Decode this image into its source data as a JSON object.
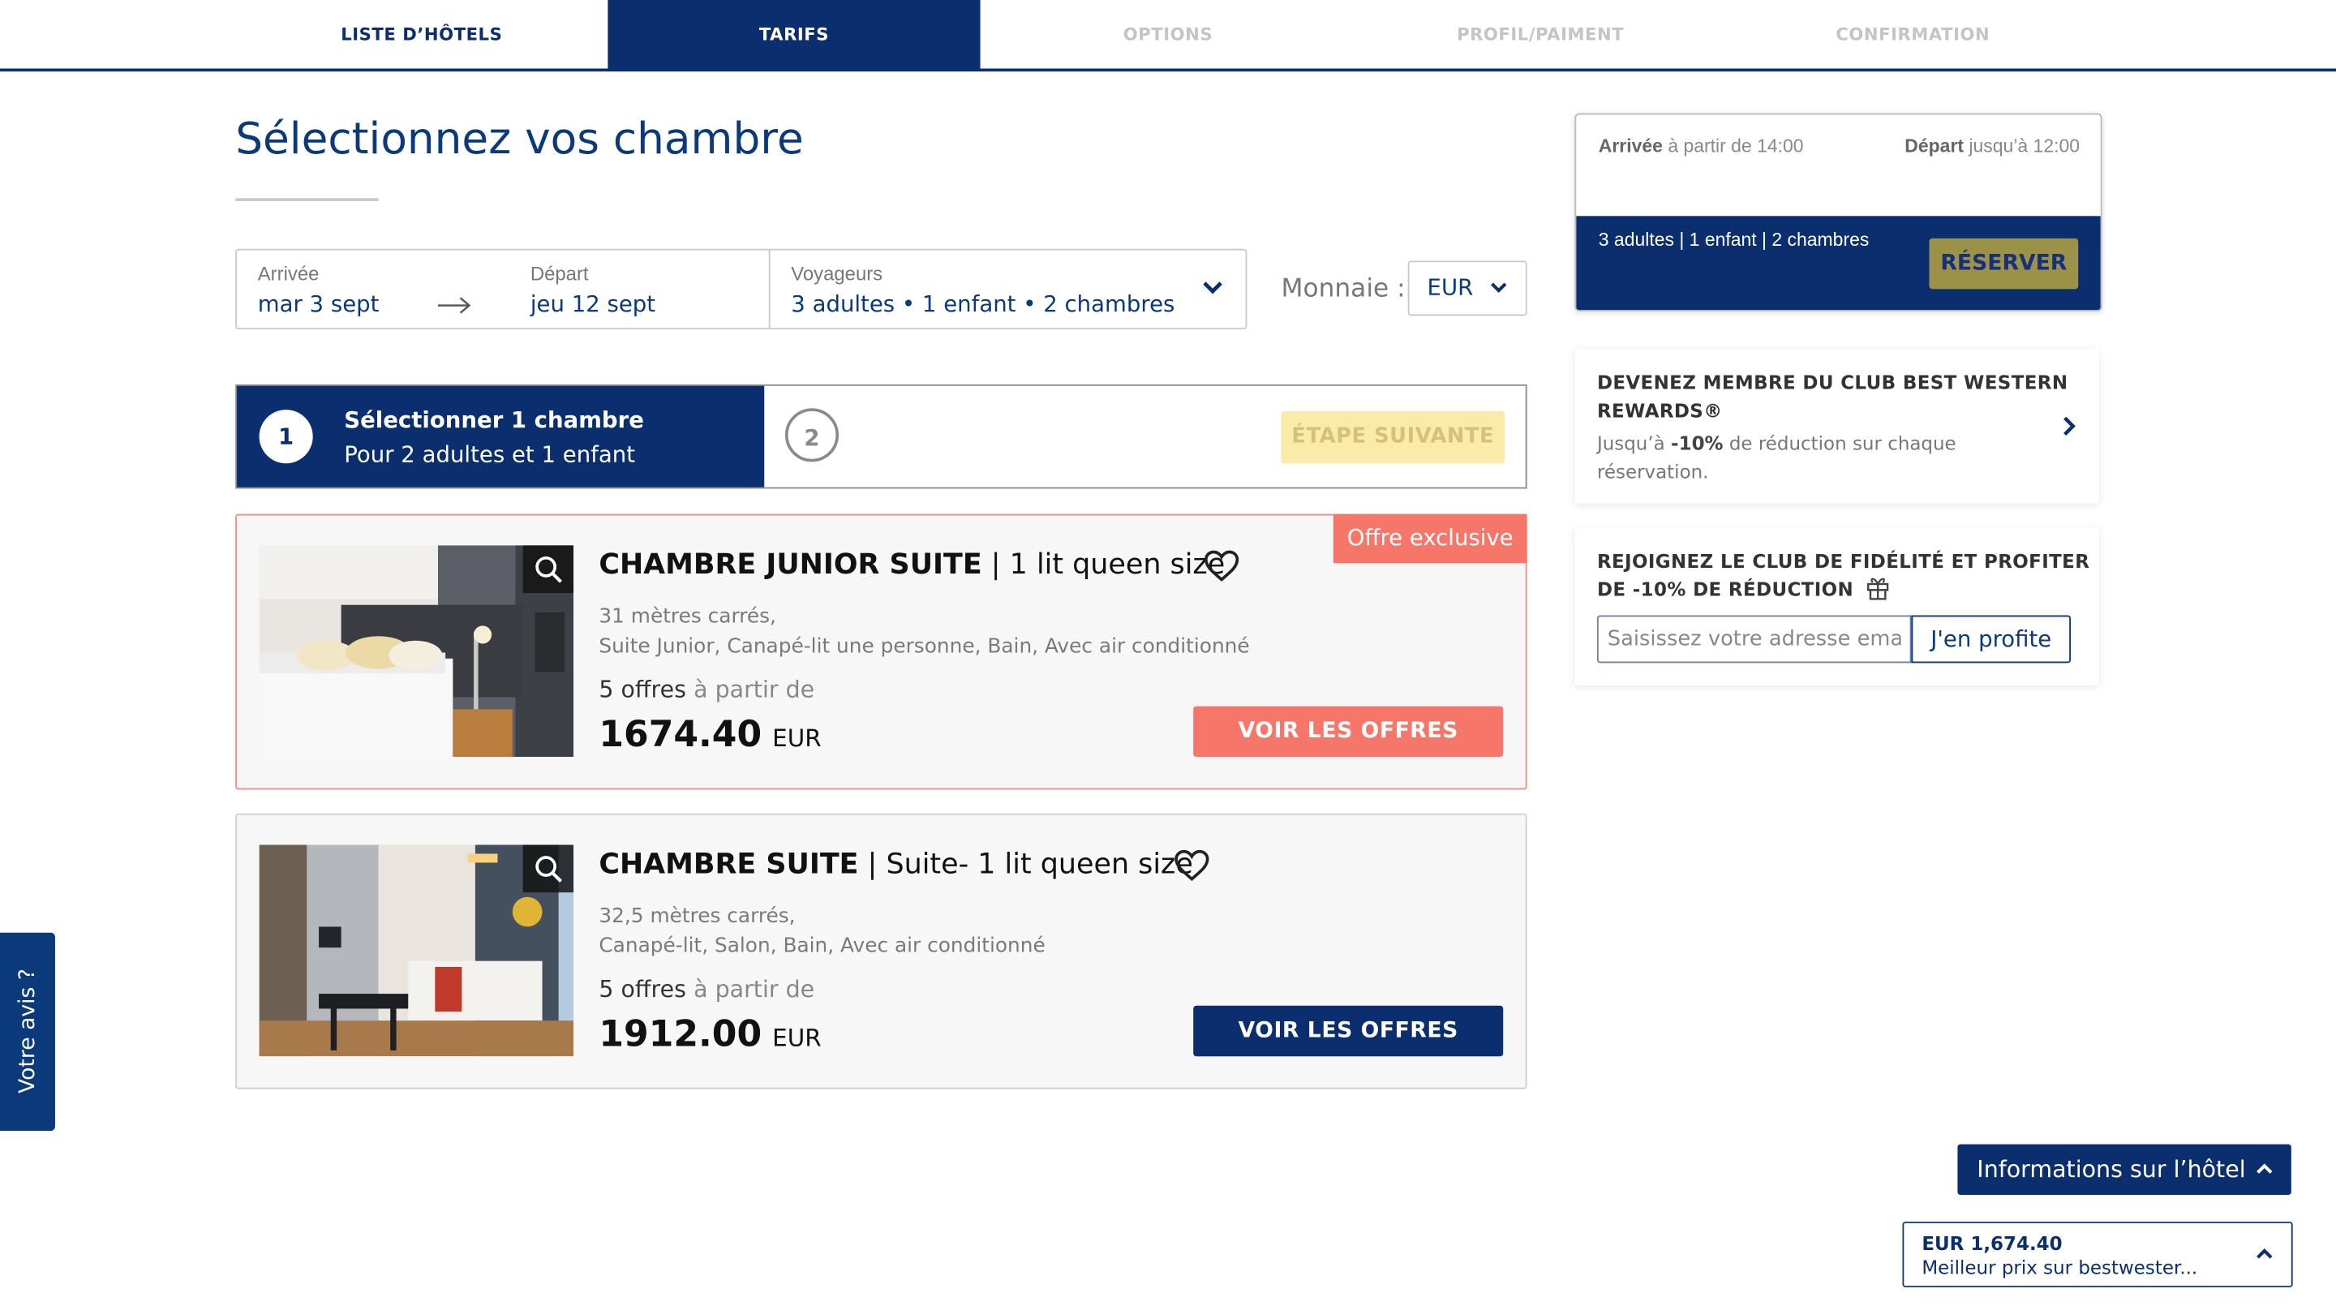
{
  "steps": [
    "LISTE D’HÔTELS",
    "TARIFS",
    "OPTIONS",
    "PROFIL/PAIMENT",
    "CONFIRMATION"
  ],
  "page_title": "Sélectionnez vos chambre",
  "search": {
    "arrival_label": "Arrivée",
    "arrival_value": "mar 3 sept",
    "departure_label": "Départ",
    "departure_value": "jeu 12 sept",
    "travelers_label": "Voyageurs",
    "travelers_value": "3 adultes • 1 enfant • 2 chambres"
  },
  "currency": {
    "label": "Monnaie :",
    "value": "EUR"
  },
  "room_steps": {
    "step1_number": "1",
    "step1_title": "Sélectionner 1 chambre",
    "step1_subtitle": "Pour 2 adultes et 1 enfant",
    "step2_number": "2",
    "next_button": "ÉTAPE SUIVANTE"
  },
  "rooms": [
    {
      "badge": "Offre exclusive",
      "name": "CHAMBRE JUNIOR SUITE",
      "bed": "1 lit queen size",
      "size": "31 mètres carrés,",
      "features": "Suite Junior, Canapé-lit une personne, Bain, Avec air conditionné",
      "offers_count": "5 offres",
      "offers_from": "à partir de",
      "price": "1674.40",
      "price_currency": "EUR",
      "button": "VOIR LES OFFRES",
      "button_color": "#f6776a"
    },
    {
      "name": "CHAMBRE SUITE",
      "bed": "Suite- 1 lit queen size",
      "size": "32,5 mètres carrés,",
      "features": "Canapé-lit, Salon, Bain, Avec air conditionné",
      "offers_count": "5 offres",
      "offers_from": "à partir de",
      "price": "1912.00",
      "price_currency": "EUR",
      "button": "VOIR LES OFFRES",
      "button_color": "#0a2e6e"
    }
  ],
  "summary": {
    "arrival_bold": "Arrivée",
    "arrival_text": "à partir de 14:00",
    "departure_bold": "Départ",
    "departure_text": "jusqu’à 12:00",
    "guests": "3 adultes | 1 enfant | 2 chambres",
    "reserve_button": "RÉSERVER"
  },
  "rewards_promo": {
    "title_line1": "DEVENEZ MEMBRE DU CLUB BEST WESTERN",
    "title_line2": "REWARDS®",
    "text_prefix": "Jusqu’à",
    "text_bold": "-10%",
    "text_suffix": "de réduction sur chaque",
    "text_line2": "réservation."
  },
  "loyalty_promo": {
    "title_line1": "REJOIGNEZ LE CLUB DE FIDÉLITÉ ET PROFITER",
    "title_line2": "DE  -10% DE RÉDUCTION",
    "email_placeholder": "Saisissez votre adresse email",
    "button": "J'en profite"
  },
  "feedback_tab": "Votre avis ?",
  "hotel_info_button": "Informations sur l’hôtel",
  "best_price": {
    "amount": "EUR 1,674.40",
    "text": "Meilleur prix sur bestwester..."
  },
  "colors": {
    "navy": "#0a2e6e",
    "coral": "#f6776a",
    "gold": "#9b9247",
    "pale_yellow": "#fbeba8"
  }
}
